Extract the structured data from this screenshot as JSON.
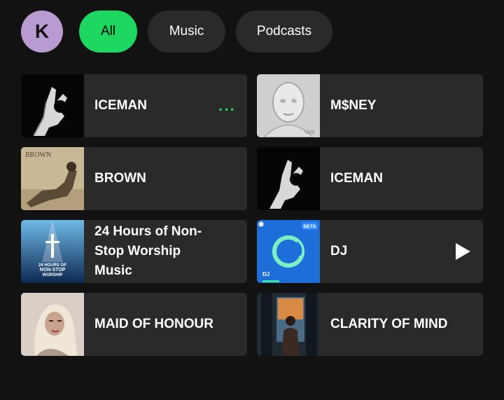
{
  "profile": {
    "initial": "K"
  },
  "filters": {
    "all": "All",
    "music": "Music",
    "podcasts": "Podcasts"
  },
  "cards": [
    {
      "title": "ICEMAN"
    },
    {
      "title": "M$NEY",
      "art_text": "VVS"
    },
    {
      "title": "BROWN",
      "art_text": "BROWN"
    },
    {
      "title": "ICEMAN"
    },
    {
      "title": "24 Hours of Non-Stop Worship Music",
      "art_text_1": "24 HOURS OF",
      "art_text_2": "NON-STOP",
      "art_text_3": "WORSHIP"
    },
    {
      "title": "DJ",
      "badge": "BETA",
      "art_label": "DJ"
    },
    {
      "title": "MAID OF HONOUR"
    },
    {
      "title": "CLARITY OF MIND"
    }
  ],
  "colors": {
    "accent": "#1ed760",
    "card": "#2a2a2a",
    "background": "#121212",
    "avatar": "#b79bd1",
    "dj_blue": "#1e6ed9"
  }
}
